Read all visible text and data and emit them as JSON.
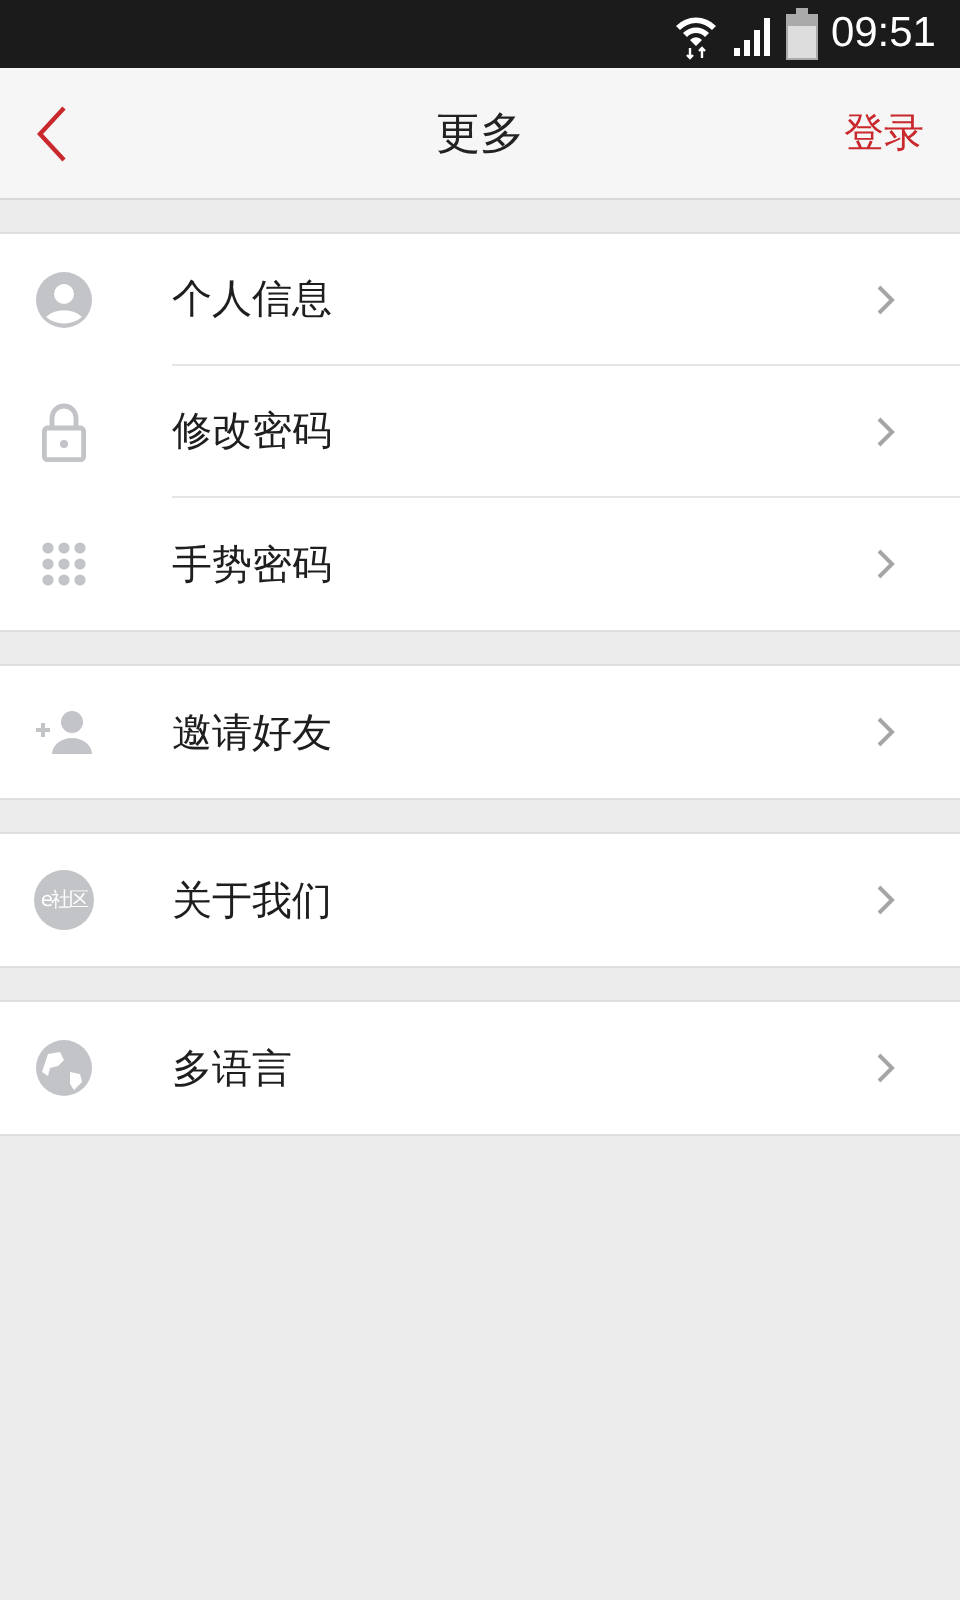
{
  "status_bar": {
    "time": "09:51"
  },
  "header": {
    "title": "更多",
    "action": "登录"
  },
  "groups": [
    {
      "items": [
        {
          "label": "个人信息"
        },
        {
          "label": "修改密码"
        },
        {
          "label": "手势密码"
        }
      ]
    },
    {
      "items": [
        {
          "label": "邀请好友"
        }
      ]
    },
    {
      "items": [
        {
          "label": "关于我们",
          "badge_text": "e社区"
        }
      ]
    },
    {
      "items": [
        {
          "label": "多语言"
        }
      ]
    }
  ]
}
